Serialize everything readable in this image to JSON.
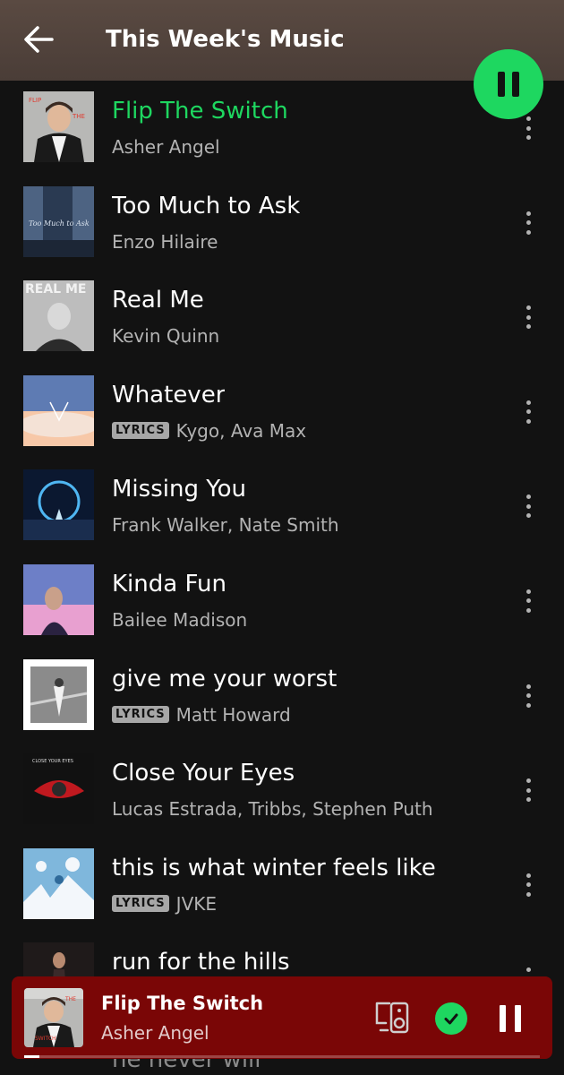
{
  "header": {
    "title": "This Week's Music"
  },
  "tracks": [
    {
      "title": "Flip The Switch",
      "artist": "Asher Angel",
      "lyrics": "",
      "active": true,
      "cover": {
        "bg": "#b8b8b6",
        "accent": "#e03a2f",
        "fg": "#1a1a1a"
      }
    },
    {
      "title": "Too Much to Ask",
      "artist": "Enzo Hilaire",
      "lyrics": "",
      "active": false,
      "cover": {
        "bg": "#2a3a52",
        "accent": "#d9e2ee",
        "fg": "#4d6382"
      }
    },
    {
      "title": "Real Me",
      "artist": "Kevin Quinn",
      "lyrics": "",
      "active": false,
      "cover": {
        "bg": "#bdbdbd",
        "accent": "#f2f2f2",
        "fg": "#2b2b2b"
      }
    },
    {
      "title": "Whatever",
      "artist": "Kygo, Ava Max",
      "lyrics": "LYRICS",
      "active": false,
      "cover": {
        "bg": "#5e7bb3",
        "accent": "#f7c8a8",
        "fg": "#f4e2d6"
      }
    },
    {
      "title": "Missing You",
      "artist": "Frank Walker, Nate Smith",
      "lyrics": "",
      "active": false,
      "cover": {
        "bg": "#0b1830",
        "accent": "#4fb6f2",
        "fg": "#1a2d4e"
      }
    },
    {
      "title": "Kinda Fun",
      "artist": "Bailee Madison",
      "lyrics": "",
      "active": false,
      "cover": {
        "bg": "#6d7fc7",
        "accent": "#e8a0d0",
        "fg": "#2a2240"
      }
    },
    {
      "title": "give me your worst",
      "artist": "Matt Howard",
      "lyrics": "LYRICS",
      "active": false,
      "cover": {
        "bg": "#f2f2f2",
        "accent": "#8b8b8b",
        "fg": "#3a3a3a"
      }
    },
    {
      "title": "Close Your Eyes",
      "artist": "Lucas Estrada, Tribbs, Stephen Puth",
      "lyrics": "",
      "active": false,
      "cover": {
        "bg": "#111111",
        "accent": "#c0191f",
        "fg": "#2a2a2a"
      }
    },
    {
      "title": "this is what winter feels like",
      "artist": "JVKE",
      "lyrics": "LYRICS",
      "active": false,
      "cover": {
        "bg": "#7fb7dc",
        "accent": "#f3f7fb",
        "fg": "#2f6a9a"
      }
    },
    {
      "title": "run for the hills",
      "artist": "",
      "lyrics": "",
      "active": false,
      "cover": {
        "bg": "#1f1a1a",
        "accent": "#b88a70",
        "fg": "#3a2a2a"
      }
    }
  ],
  "peek_title": "he never will",
  "now_playing": {
    "title": "Flip The Switch",
    "artist": "Asher Angel",
    "progress": 0.03,
    "saved": true,
    "bg_color": "#7a0606"
  },
  "colors": {
    "accent_green": "#1ed760",
    "background": "#121212"
  },
  "icons": {
    "back": "arrow-left-icon",
    "more": "more-vertical-icon",
    "devices": "devices-icon",
    "saved": "check-circle-icon",
    "pause": "pause-icon"
  }
}
